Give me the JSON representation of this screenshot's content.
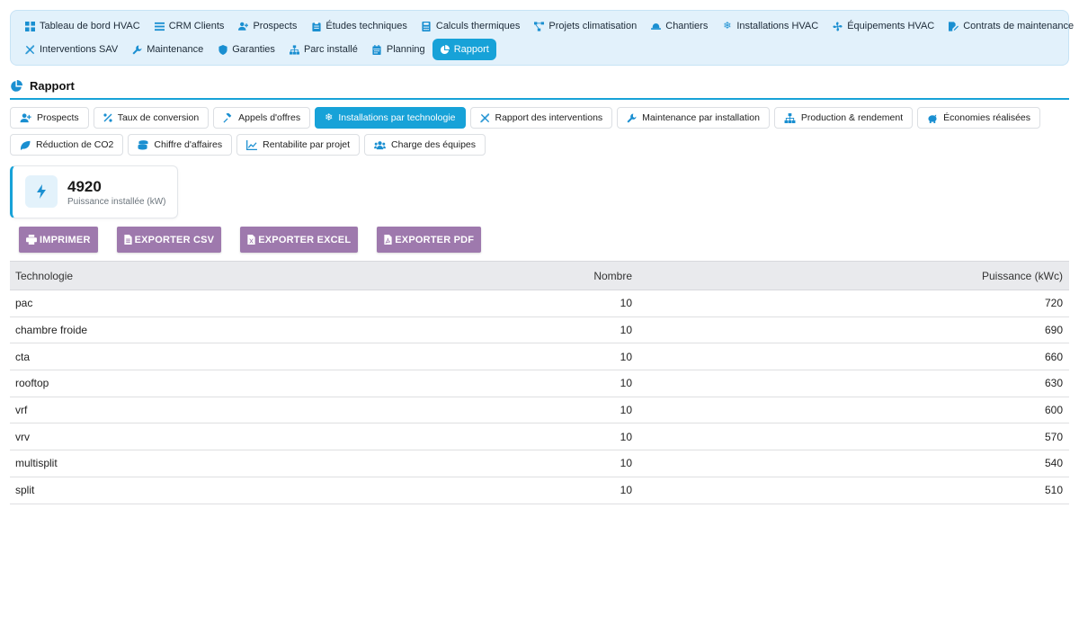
{
  "nav": {
    "row1": [
      {
        "label": "Tableau de bord HVAC",
        "icon": "dashboard-icon"
      },
      {
        "label": "CRM Clients",
        "icon": "list-icon"
      },
      {
        "label": "Prospects",
        "icon": "user-plus-icon"
      },
      {
        "label": "Études techniques",
        "icon": "clipboard-icon"
      },
      {
        "label": "Calculs thermiques",
        "icon": "calculator-icon"
      },
      {
        "label": "Projets climatisation",
        "icon": "project-diagram-icon"
      },
      {
        "label": "Chantiers",
        "icon": "hard-hat-icon"
      },
      {
        "label": "Installations HVAC",
        "icon": "snowflake-icon"
      },
      {
        "label": "Équipements HVAC",
        "icon": "fan-icon"
      },
      {
        "label": "Contrats de maintenance",
        "icon": "file-signature-icon"
      }
    ],
    "row2": [
      {
        "label": "Interventions SAV",
        "icon": "tools-icon"
      },
      {
        "label": "Maintenance",
        "icon": "wrench-icon"
      },
      {
        "label": "Garanties",
        "icon": "shield-icon"
      },
      {
        "label": "Parc installé",
        "icon": "sitemap-icon"
      },
      {
        "label": "Planning",
        "icon": "calendar-icon"
      },
      {
        "label": "Rapport",
        "icon": "pie-chart-icon",
        "active": true
      }
    ]
  },
  "section": {
    "title": "Rapport"
  },
  "tabs": {
    "row1": [
      {
        "label": "Prospects",
        "icon": "user-plus-icon"
      },
      {
        "label": "Taux de conversion",
        "icon": "percent-icon"
      },
      {
        "label": "Appels d'offres",
        "icon": "gavel-icon"
      },
      {
        "label": "Installations par technologie",
        "icon": "snowflake-icon",
        "active": true
      },
      {
        "label": "Rapport des interventions",
        "icon": "tools-icon"
      },
      {
        "label": "Maintenance par installation",
        "icon": "wrench-icon"
      },
      {
        "label": "Production & rendement",
        "icon": "sitemap-icon"
      },
      {
        "label": "Économies réalisées",
        "icon": "piggy-bank-icon"
      }
    ],
    "row2": [
      {
        "label": "Réduction de CO2",
        "icon": "leaf-icon"
      },
      {
        "label": "Chiffre d'affaires",
        "icon": "coins-icon"
      },
      {
        "label": "Rentabilite par projet",
        "icon": "chart-line-icon"
      },
      {
        "label": "Charge des équipes",
        "icon": "users-icon"
      }
    ]
  },
  "stat": {
    "value": "4920",
    "label": "Puissance installée (kW)",
    "icon": "bolt-icon"
  },
  "actions": [
    {
      "label": "IMPRIMER",
      "icon": "print-icon"
    },
    {
      "label": "EXPORTER CSV",
      "icon": "file-csv-icon"
    },
    {
      "label": "EXPORTER EXCEL",
      "icon": "file-excel-icon"
    },
    {
      "label": "EXPORTER PDF",
      "icon": "file-pdf-icon"
    }
  ],
  "table": {
    "headers": [
      "Technologie",
      "Nombre",
      "Puissance (kWc)"
    ],
    "rows": [
      [
        "pac",
        "10",
        "720"
      ],
      [
        "chambre froide",
        "10",
        "690"
      ],
      [
        "cta",
        "10",
        "660"
      ],
      [
        "rooftop",
        "10",
        "630"
      ],
      [
        "vrf",
        "10",
        "600"
      ],
      [
        "vrv",
        "10",
        "570"
      ],
      [
        "multisplit",
        "10",
        "540"
      ],
      [
        "split",
        "10",
        "510"
      ]
    ]
  },
  "colors": {
    "accent": "#17a2d8",
    "button": "#9e79ad",
    "nav_bg": "#e2f1fb"
  }
}
